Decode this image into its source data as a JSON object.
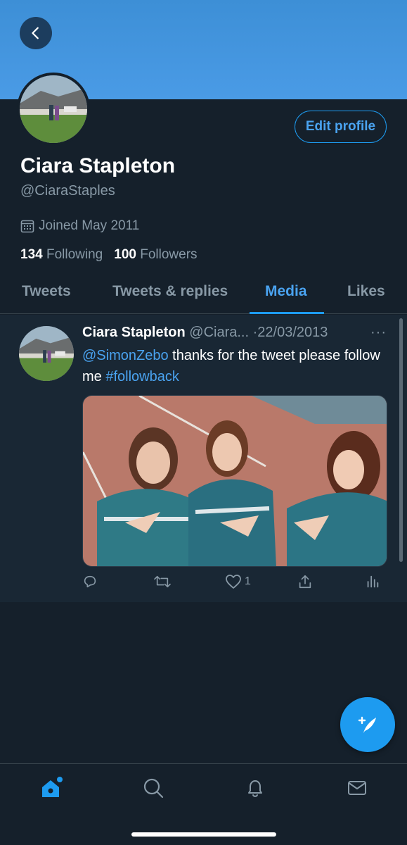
{
  "profile": {
    "name": "Ciara Stapleton",
    "handle": "@CiaraStaples",
    "joined": "Joined May 2011",
    "following_count": "134",
    "following_label": "Following",
    "followers_count": "100",
    "followers_label": "Followers",
    "edit_label": "Edit profile"
  },
  "tabs": [
    {
      "label": "Tweets"
    },
    {
      "label": "Tweets & replies"
    },
    {
      "label": "Media"
    },
    {
      "label": "Likes"
    }
  ],
  "active_tab": "Media",
  "tweet": {
    "name": "Ciara Stapleton",
    "handle_truncated": "@Ciara...",
    "separator": "·",
    "date": "22/03/2013",
    "more": "···",
    "mention": "@SimonZebo",
    "text_1": " thanks for the tweet please follow me ",
    "hashtag": "#followback",
    "like_count": "1"
  },
  "colors": {
    "background": "#15202b",
    "banner": "#4a9be6",
    "accent": "#1d9bf0",
    "secondary_text": "#8899a6"
  },
  "icons": {
    "back": "arrow-left-icon",
    "calendar": "calendar-icon",
    "reply": "reply-icon",
    "retweet": "retweet-icon",
    "like": "heart-icon",
    "share": "share-icon",
    "analytics": "analytics-icon",
    "compose": "compose-tweet-icon",
    "home": "home-icon",
    "search": "search-icon",
    "notifications": "bell-icon",
    "messages": "mail-icon"
  }
}
